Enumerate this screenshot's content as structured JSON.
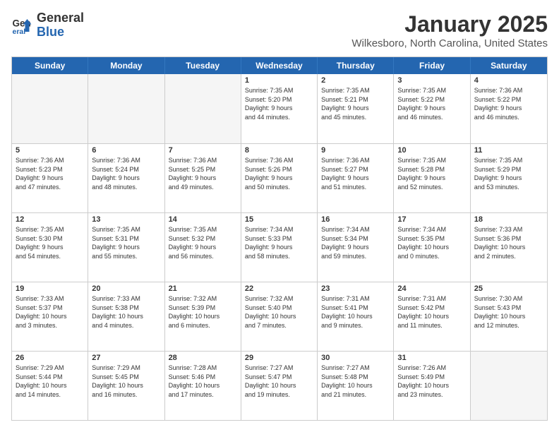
{
  "header": {
    "logo_line1": "General",
    "logo_line2": "Blue",
    "month": "January 2025",
    "location": "Wilkesboro, North Carolina, United States"
  },
  "weekdays": [
    "Sunday",
    "Monday",
    "Tuesday",
    "Wednesday",
    "Thursday",
    "Friday",
    "Saturday"
  ],
  "weeks": [
    [
      {
        "day": "",
        "info": ""
      },
      {
        "day": "",
        "info": ""
      },
      {
        "day": "",
        "info": ""
      },
      {
        "day": "1",
        "info": "Sunrise: 7:35 AM\nSunset: 5:20 PM\nDaylight: 9 hours\nand 44 minutes."
      },
      {
        "day": "2",
        "info": "Sunrise: 7:35 AM\nSunset: 5:21 PM\nDaylight: 9 hours\nand 45 minutes."
      },
      {
        "day": "3",
        "info": "Sunrise: 7:35 AM\nSunset: 5:22 PM\nDaylight: 9 hours\nand 46 minutes."
      },
      {
        "day": "4",
        "info": "Sunrise: 7:36 AM\nSunset: 5:22 PM\nDaylight: 9 hours\nand 46 minutes."
      }
    ],
    [
      {
        "day": "5",
        "info": "Sunrise: 7:36 AM\nSunset: 5:23 PM\nDaylight: 9 hours\nand 47 minutes."
      },
      {
        "day": "6",
        "info": "Sunrise: 7:36 AM\nSunset: 5:24 PM\nDaylight: 9 hours\nand 48 minutes."
      },
      {
        "day": "7",
        "info": "Sunrise: 7:36 AM\nSunset: 5:25 PM\nDaylight: 9 hours\nand 49 minutes."
      },
      {
        "day": "8",
        "info": "Sunrise: 7:36 AM\nSunset: 5:26 PM\nDaylight: 9 hours\nand 50 minutes."
      },
      {
        "day": "9",
        "info": "Sunrise: 7:36 AM\nSunset: 5:27 PM\nDaylight: 9 hours\nand 51 minutes."
      },
      {
        "day": "10",
        "info": "Sunrise: 7:35 AM\nSunset: 5:28 PM\nDaylight: 9 hours\nand 52 minutes."
      },
      {
        "day": "11",
        "info": "Sunrise: 7:35 AM\nSunset: 5:29 PM\nDaylight: 9 hours\nand 53 minutes."
      }
    ],
    [
      {
        "day": "12",
        "info": "Sunrise: 7:35 AM\nSunset: 5:30 PM\nDaylight: 9 hours\nand 54 minutes."
      },
      {
        "day": "13",
        "info": "Sunrise: 7:35 AM\nSunset: 5:31 PM\nDaylight: 9 hours\nand 55 minutes."
      },
      {
        "day": "14",
        "info": "Sunrise: 7:35 AM\nSunset: 5:32 PM\nDaylight: 9 hours\nand 56 minutes."
      },
      {
        "day": "15",
        "info": "Sunrise: 7:34 AM\nSunset: 5:33 PM\nDaylight: 9 hours\nand 58 minutes."
      },
      {
        "day": "16",
        "info": "Sunrise: 7:34 AM\nSunset: 5:34 PM\nDaylight: 9 hours\nand 59 minutes."
      },
      {
        "day": "17",
        "info": "Sunrise: 7:34 AM\nSunset: 5:35 PM\nDaylight: 10 hours\nand 0 minutes."
      },
      {
        "day": "18",
        "info": "Sunrise: 7:33 AM\nSunset: 5:36 PM\nDaylight: 10 hours\nand 2 minutes."
      }
    ],
    [
      {
        "day": "19",
        "info": "Sunrise: 7:33 AM\nSunset: 5:37 PM\nDaylight: 10 hours\nand 3 minutes."
      },
      {
        "day": "20",
        "info": "Sunrise: 7:33 AM\nSunset: 5:38 PM\nDaylight: 10 hours\nand 4 minutes."
      },
      {
        "day": "21",
        "info": "Sunrise: 7:32 AM\nSunset: 5:39 PM\nDaylight: 10 hours\nand 6 minutes."
      },
      {
        "day": "22",
        "info": "Sunrise: 7:32 AM\nSunset: 5:40 PM\nDaylight: 10 hours\nand 7 minutes."
      },
      {
        "day": "23",
        "info": "Sunrise: 7:31 AM\nSunset: 5:41 PM\nDaylight: 10 hours\nand 9 minutes."
      },
      {
        "day": "24",
        "info": "Sunrise: 7:31 AM\nSunset: 5:42 PM\nDaylight: 10 hours\nand 11 minutes."
      },
      {
        "day": "25",
        "info": "Sunrise: 7:30 AM\nSunset: 5:43 PM\nDaylight: 10 hours\nand 12 minutes."
      }
    ],
    [
      {
        "day": "26",
        "info": "Sunrise: 7:29 AM\nSunset: 5:44 PM\nDaylight: 10 hours\nand 14 minutes."
      },
      {
        "day": "27",
        "info": "Sunrise: 7:29 AM\nSunset: 5:45 PM\nDaylight: 10 hours\nand 16 minutes."
      },
      {
        "day": "28",
        "info": "Sunrise: 7:28 AM\nSunset: 5:46 PM\nDaylight: 10 hours\nand 17 minutes."
      },
      {
        "day": "29",
        "info": "Sunrise: 7:27 AM\nSunset: 5:47 PM\nDaylight: 10 hours\nand 19 minutes."
      },
      {
        "day": "30",
        "info": "Sunrise: 7:27 AM\nSunset: 5:48 PM\nDaylight: 10 hours\nand 21 minutes."
      },
      {
        "day": "31",
        "info": "Sunrise: 7:26 AM\nSunset: 5:49 PM\nDaylight: 10 hours\nand 23 minutes."
      },
      {
        "day": "",
        "info": ""
      }
    ]
  ]
}
